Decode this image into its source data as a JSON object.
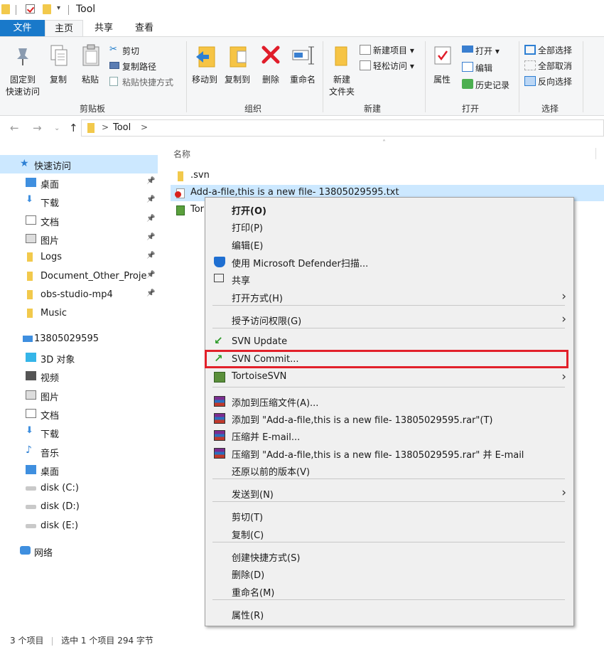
{
  "window": {
    "title": "Tool"
  },
  "tabs": {
    "file": "文件",
    "home": "主页",
    "share": "共享",
    "view": "查看"
  },
  "ribbon": {
    "clipboard": {
      "pin": "固定到\n快速访问",
      "copy": "复制",
      "paste": "粘贴",
      "cut": "剪切",
      "copy_path": "复制路径",
      "paste_shortcut": "粘贴快捷方式",
      "label": "剪贴板"
    },
    "organize": {
      "move_to": "移动到",
      "copy_to": "复制到",
      "delete": "删除",
      "rename": "重命名",
      "label": "组织"
    },
    "new": {
      "new_folder": "新建\n文件夹",
      "new_item": "新建项目 ▾",
      "easy_access": "轻松访问 ▾",
      "label": "新建"
    },
    "open": {
      "properties": "属性",
      "open": "打开 ▾",
      "edit": "编辑",
      "history": "历史记录",
      "label": "打开"
    },
    "select": {
      "select_all": "全部选择",
      "select_none": "全部取消",
      "invert": "反向选择",
      "label": "选择"
    }
  },
  "address": {
    "crumb": "Tool",
    "sep": ">",
    "sep2": ">"
  },
  "nav": {
    "quick_access": "快速访问",
    "items": [
      {
        "label": "桌面",
        "icon": "desktop-icon",
        "pinned": true
      },
      {
        "label": "下载",
        "icon": "download-icon",
        "pinned": true
      },
      {
        "label": "文档",
        "icon": "document-icon",
        "pinned": true
      },
      {
        "label": "图片",
        "icon": "picture-icon",
        "pinned": true
      },
      {
        "label": "Logs",
        "icon": "folder-icon",
        "pinned": true
      },
      {
        "label": "Document_Other_Proje",
        "icon": "folder-icon",
        "pinned": true
      },
      {
        "label": "obs-studio-mp4",
        "icon": "folder-icon",
        "pinned": true
      },
      {
        "label": "Music",
        "icon": "folder-icon",
        "pinned": false
      }
    ],
    "pc": "13805029595",
    "pc_items": [
      {
        "label": "3D 对象",
        "icon": "3d-objects-icon"
      },
      {
        "label": "视频",
        "icon": "video-icon"
      },
      {
        "label": "图片",
        "icon": "picture-icon"
      },
      {
        "label": "文档",
        "icon": "document-icon"
      },
      {
        "label": "下载",
        "icon": "download-icon"
      },
      {
        "label": "音乐",
        "icon": "music-icon"
      },
      {
        "label": "桌面",
        "icon": "desktop-icon"
      },
      {
        "label": "disk (C:)",
        "icon": "drive-icon"
      },
      {
        "label": "disk (D:)",
        "icon": "drive-icon"
      },
      {
        "label": "disk (E:)",
        "icon": "drive-icon"
      }
    ],
    "network": "网络"
  },
  "files": {
    "column_name": "名称",
    "rows": [
      {
        "name": ".svn",
        "icon": "folder-icon",
        "selected": false
      },
      {
        "name": "Add-a-file,this is a new file- 13805029595.txt",
        "icon": "svn-modified-file-icon",
        "selected": true
      },
      {
        "name": "Tor",
        "icon": "tortoisesvn-file-icon",
        "selected": false
      }
    ]
  },
  "status": {
    "count": "3 个项目",
    "selected": "选中 1 个项目  294 字节"
  },
  "context_menu": {
    "items": [
      {
        "label": "打开(O)",
        "bold": true
      },
      {
        "label": "打印(P)"
      },
      {
        "label": "编辑(E)"
      },
      {
        "label": "使用 Microsoft Defender扫描...",
        "icon": "defender-icon"
      },
      {
        "label": "共享",
        "icon": "share-icon"
      },
      {
        "label": "打开方式(H)",
        "submenu": true
      },
      {
        "label": "授予访问权限(G)",
        "submenu": true
      },
      {
        "label": "SVN Update",
        "icon": "svn-update-icon"
      },
      {
        "label": "SVN Commit...",
        "icon": "svn-commit-icon",
        "highlighted": true
      },
      {
        "label": "TortoiseSVN",
        "icon": "tortoisesvn-icon",
        "submenu": true
      },
      {
        "label": "添加到压缩文件(A)...",
        "icon": "winrar-icon"
      },
      {
        "label": "添加到 \"Add-a-file,this is a new file- 13805029595.rar\"(T)",
        "icon": "winrar-icon"
      },
      {
        "label": "压缩并 E-mail...",
        "icon": "winrar-icon"
      },
      {
        "label": "压缩到 \"Add-a-file,this is a new file- 13805029595.rar\" 并 E-mail",
        "icon": "winrar-icon"
      },
      {
        "label": "还原以前的版本(V)"
      },
      {
        "label": "发送到(N)",
        "submenu": true
      },
      {
        "label": "剪切(T)"
      },
      {
        "label": "复制(C)"
      },
      {
        "label": "创建快捷方式(S)"
      },
      {
        "label": "删除(D)"
      },
      {
        "label": "重命名(M)"
      },
      {
        "label": "属性(R)"
      }
    ],
    "submenu_arrow": "›"
  },
  "colors": {
    "accent": "#1979ca",
    "selection": "#cce8ff",
    "highlight_box": "#e2202a"
  }
}
